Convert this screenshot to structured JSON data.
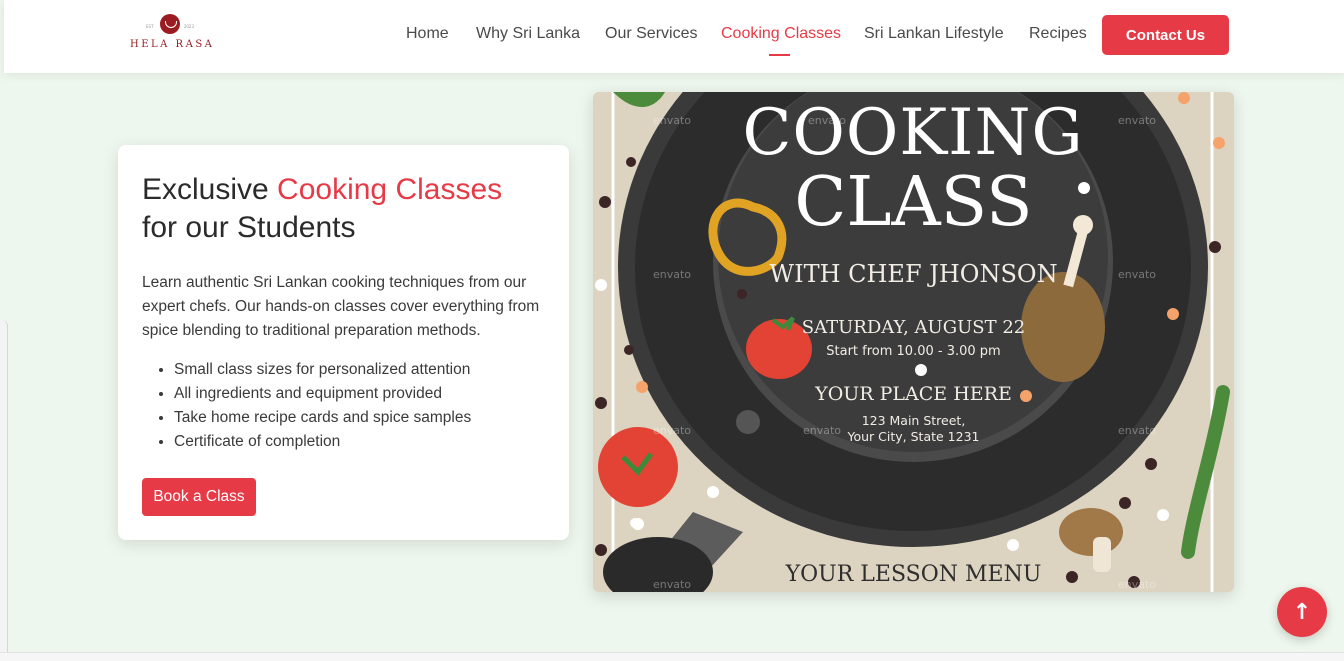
{
  "brand": {
    "name": "HELA RASA",
    "year_left": "EST",
    "year_right": "2023"
  },
  "nav": {
    "items": [
      {
        "label": "Home"
      },
      {
        "label": "Why Sri Lanka"
      },
      {
        "label": "Our Services"
      },
      {
        "label": "Cooking Classes",
        "active": true
      },
      {
        "label": "Sri Lankan Lifestyle"
      },
      {
        "label": "Recipes"
      }
    ],
    "contact_label": "Contact Us"
  },
  "card": {
    "title_prefix": "Exclusive ",
    "title_accent": "Cooking Classes",
    "title_suffix": "for our Students",
    "description": "Learn authentic Sri Lankan cooking techniques from our expert chefs. Our hands-on classes cover everything from spice blending to traditional preparation methods.",
    "features": [
      "Small class sizes for personalized attention",
      "All ingredients and equipment provided",
      "Take home recipe cards and spice samples",
      "Certificate of completion"
    ],
    "button_label": "Book a Class"
  },
  "poster": {
    "line1": "COOKING",
    "line2": "CLASS",
    "chef": "WITH CHEF JHONSON",
    "date": "SATURDAY, AUGUST 22",
    "time": "Start from 10.00 - 3.00 pm",
    "place": "YOUR PLACE HERE",
    "address1": "123 Main Street,",
    "address2": "Your City, State 1231",
    "menu": "YOUR LESSON MENU",
    "watermark": "envato"
  },
  "back_to_top": "↑",
  "colors": {
    "accent": "#e63a47",
    "page_bg": "#eef7ee",
    "pan": "#2b2b2b"
  }
}
